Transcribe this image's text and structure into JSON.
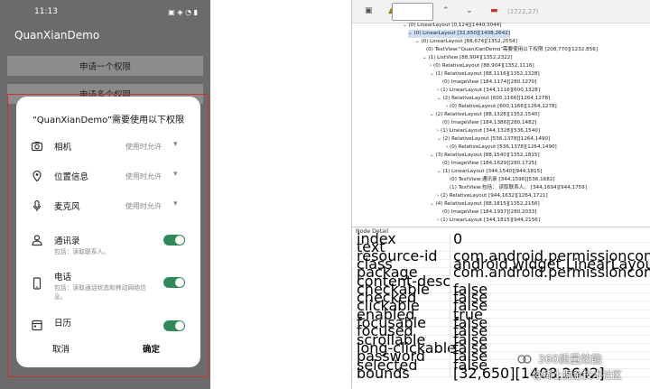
{
  "phone": {
    "time": "11:13",
    "status_icons": "▣ ◈ ◔ ▮",
    "app_title": "QuanXianDemo",
    "buttons": [
      "申请一个权限",
      "申请多个权限"
    ],
    "dialog": {
      "title": "“QuanXianDemo”需要使用以下权限",
      "permissions": [
        {
          "icon": "camera-icon",
          "name": "相机",
          "value": "使用时允许"
        },
        {
          "icon": "location-icon",
          "name": "位置信息",
          "value": "使用时允许"
        },
        {
          "icon": "microphone-icon",
          "name": "麦克风",
          "value": "使用时允许"
        },
        {
          "icon": "contacts-icon",
          "name": "通讯录",
          "desc": "包括：读取联系人。"
        },
        {
          "icon": "phone-icon",
          "name": "电话",
          "desc": "包括：读取通话状态和移动网络信息。"
        },
        {
          "icon": "calendar-icon",
          "name": "日历"
        }
      ],
      "cancel": "取消",
      "ok": "确定"
    },
    "accent_color": "#2e8b57"
  },
  "inspector": {
    "coord_readout": "(1722,27)",
    "tree": [
      "(0) LinearLayout [0,124][1440,3044]",
      "(0) LinearLayout [32,650][1408,2642]",
      "(0) LinearLayout [88,674][1352,2554]",
      "(0) TextView:\"QuanXianDemo\"需要使用以下权限  [208,770][1232,856]",
      "(1) ListView [88,904][1352,2322]",
      "(0) RelativeLayout [88,904][1352,1116]",
      "(1) RelativeLayout [88,1116][1352,1328]",
      "(0) ImageView [184,1174][280,1270]",
      "(1) LinearLayout [344,1116][600,1328]",
      "(2) RelativeLayout [600,1166][1264,1278]",
      "(0) RelativeLayout [600,1166][1264,1278]",
      "(2) RelativeLayout [88,1328][1352,1540]",
      "(0) ImageView [184,1386][280,1482]",
      "(1) LinearLayout [344,1328][536,1540]",
      "(2) RelativeLayout [536,1378][1264,1490]",
      "(0) RelativeLayout [536,1378][1264,1490]",
      "(3) RelativeLayout [88,1540][1352,1815]",
      "(0) ImageView [184,1629][280,1725]",
      "(1) LinearLayout [344,1540][944,1815]",
      "(0) TextView:通讯录 [344,1596][536,1682]",
      "(1) TextView:包括：  读取联系人。  [344,1694][944,1759]",
      "(2) RelativeLayout [944,1632][1264,1721]",
      "(4) RelativeLayout [88,1815][1352,2156]",
      "(0) ImageView [184,1937][280,2033]",
      "(1) LinearLayout [344,1815][944,2156]"
    ],
    "detail_header": "Node Detail",
    "details": [
      {
        "k": "index",
        "v": "0"
      },
      {
        "k": "text",
        "v": ""
      },
      {
        "k": "resource-id",
        "v": "com.android.permissioncontroller:id/grant_dialog"
      },
      {
        "k": "class",
        "v": "android.widget.LinearLayout"
      },
      {
        "k": "package",
        "v": "com.android.permissioncontroller"
      },
      {
        "k": "content-desc",
        "v": ""
      },
      {
        "k": "checkable",
        "v": "false"
      },
      {
        "k": "checked",
        "v": "false"
      },
      {
        "k": "clickable",
        "v": "false"
      },
      {
        "k": "enabled",
        "v": "true"
      },
      {
        "k": "focusable",
        "v": "false"
      },
      {
        "k": "focused",
        "v": "false"
      },
      {
        "k": "scrollable",
        "v": "false"
      },
      {
        "k": "long-clickable",
        "v": "false"
      },
      {
        "k": "password",
        "v": "false"
      },
      {
        "k": "selected",
        "v": "false"
      },
      {
        "k": "bounds",
        "v": "[32,650][1408,2642]"
      }
    ]
  },
  "watermark": {
    "line1": "360质量效能",
    "line2": "@稀土掘金技术社区"
  }
}
